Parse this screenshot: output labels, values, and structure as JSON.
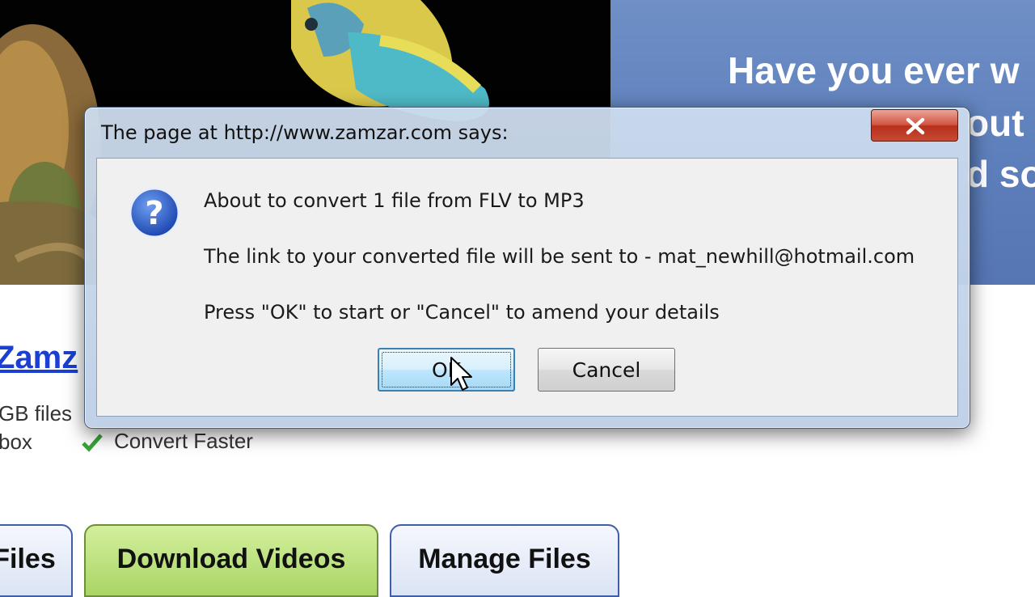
{
  "background_page": {
    "banner_lines": [
      "Have you ever w",
      "out",
      "d so"
    ],
    "brand_link": "Zamz",
    "features": [
      "GB files",
      "box",
      "Convert Faster"
    ],
    "tabs": [
      {
        "label": "Files",
        "active": false
      },
      {
        "label": "Download Videos",
        "active": true
      },
      {
        "label": "Manage Files",
        "active": false
      }
    ]
  },
  "dialog": {
    "title": "The page at http://www.zamzar.com says:",
    "close_icon": "close-x-icon",
    "message_icon": "question-icon",
    "messages": [
      "About to convert 1 file from FLV to MP3",
      "The link to your converted file will be sent to - mat_newhill@hotmail.com",
      "Press \"OK\" to start or \"Cancel\" to amend your details"
    ],
    "buttons": {
      "ok": "OK",
      "cancel": "Cancel"
    }
  },
  "colors": {
    "banner_blue": "#6f8fc6",
    "link_blue": "#1b3fd0",
    "active_tab_green": "#a9d566",
    "close_red": "#c94a33",
    "focus_blue": "#3c7fb1"
  }
}
